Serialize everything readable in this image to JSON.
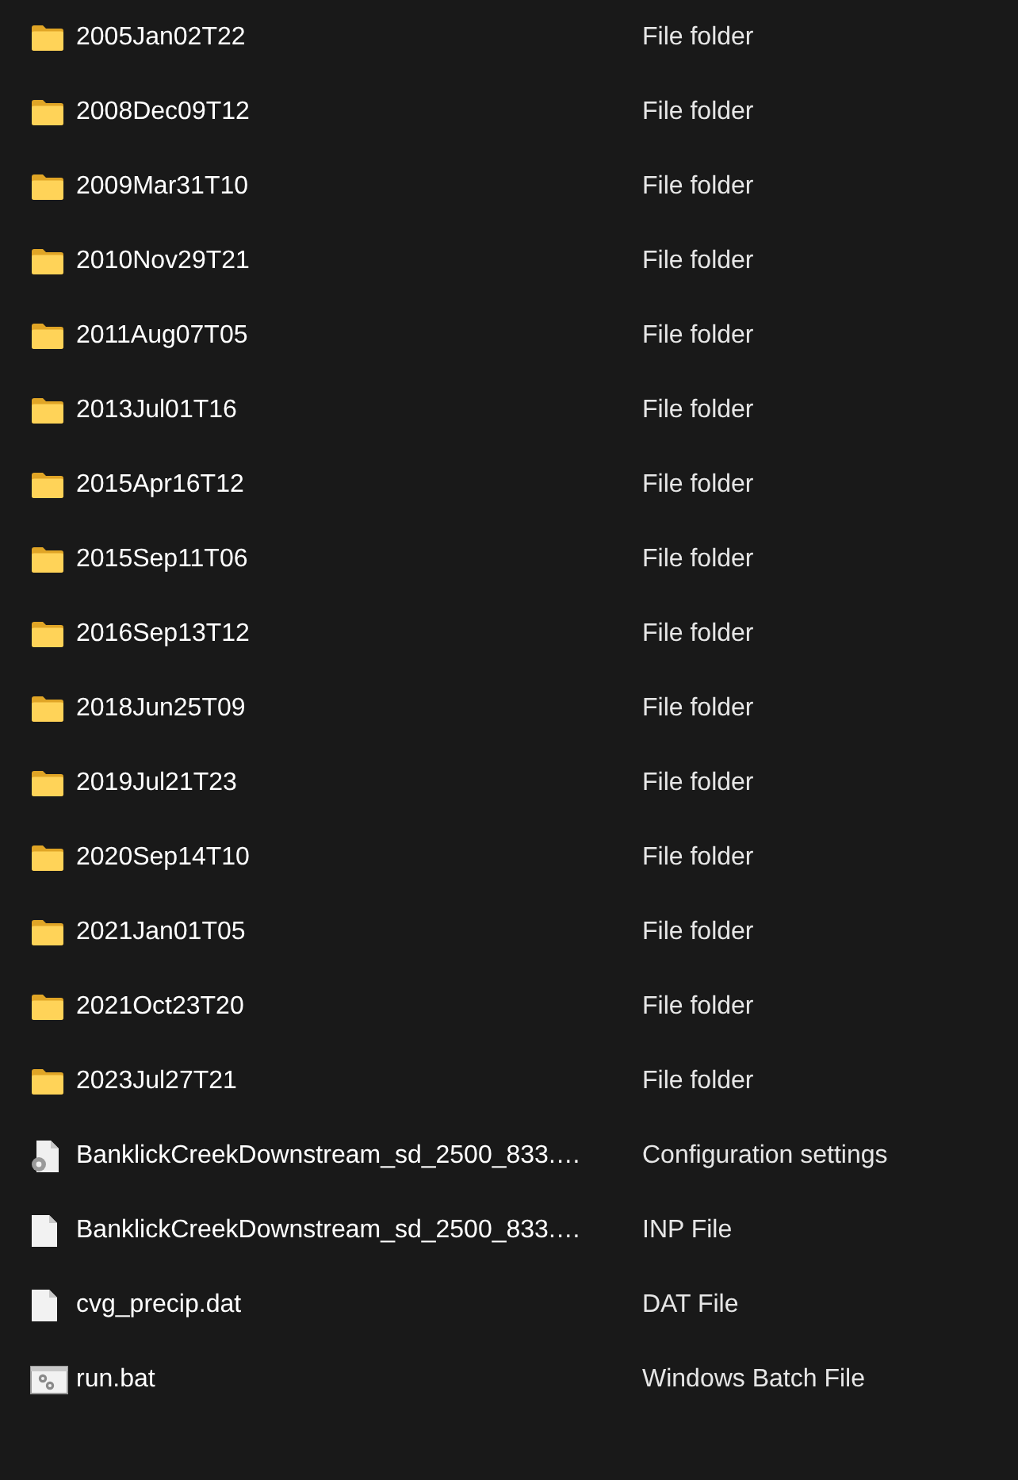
{
  "files": [
    {
      "kind": "folder",
      "name": "2005Jan02T22",
      "type": "File folder"
    },
    {
      "kind": "folder",
      "name": "2008Dec09T12",
      "type": "File folder"
    },
    {
      "kind": "folder",
      "name": "2009Mar31T10",
      "type": "File folder"
    },
    {
      "kind": "folder",
      "name": "2010Nov29T21",
      "type": "File folder"
    },
    {
      "kind": "folder",
      "name": "2011Aug07T05",
      "type": "File folder"
    },
    {
      "kind": "folder",
      "name": "2013Jul01T16",
      "type": "File folder"
    },
    {
      "kind": "folder",
      "name": "2015Apr16T12",
      "type": "File folder"
    },
    {
      "kind": "folder",
      "name": "2015Sep11T06",
      "type": "File folder"
    },
    {
      "kind": "folder",
      "name": "2016Sep13T12",
      "type": "File folder"
    },
    {
      "kind": "folder",
      "name": "2018Jun25T09",
      "type": "File folder"
    },
    {
      "kind": "folder",
      "name": "2019Jul21T23",
      "type": "File folder"
    },
    {
      "kind": "folder",
      "name": "2020Sep14T10",
      "type": "File folder"
    },
    {
      "kind": "folder",
      "name": "2021Jan01T05",
      "type": "File folder"
    },
    {
      "kind": "folder",
      "name": "2021Oct23T20",
      "type": "File folder"
    },
    {
      "kind": "folder",
      "name": "2023Jul27T21",
      "type": "File folder"
    },
    {
      "kind": "settings",
      "name": "BanklickCreekDownstream_sd_2500_833.…",
      "type": "Configuration settings"
    },
    {
      "kind": "document",
      "name": "BanklickCreekDownstream_sd_2500_833.…",
      "type": "INP File"
    },
    {
      "kind": "document",
      "name": "cvg_precip.dat",
      "type": "DAT File"
    },
    {
      "kind": "batch",
      "name": "run.bat",
      "type": "Windows Batch File"
    }
  ]
}
